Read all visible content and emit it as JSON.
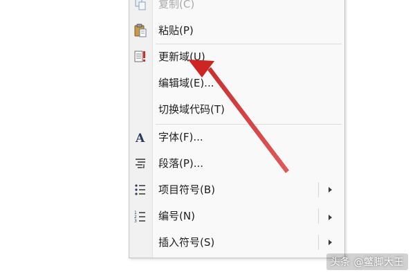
{
  "context_menu": {
    "items": [
      {
        "label": "复制(C)",
        "icon": "copy-icon",
        "disabled": true
      },
      {
        "label": "粘贴(P)",
        "icon": "paste-icon"
      },
      {
        "label": "更新域(U)",
        "icon": "update-field-icon"
      },
      {
        "label": "编辑域(E)...",
        "icon": ""
      },
      {
        "label": "切换域代码(T)",
        "icon": ""
      },
      {
        "label": "字体(F)...",
        "icon": "font-icon"
      },
      {
        "label": "段落(P)...",
        "icon": "paragraph-icon"
      },
      {
        "label": "项目符号(B)",
        "icon": "bullets-icon",
        "submenu": true
      },
      {
        "label": "编号(N)",
        "icon": "numbering-icon",
        "submenu": true
      },
      {
        "label": "插入符号(S)",
        "icon": "",
        "submenu": true
      }
    ]
  },
  "annotation": {
    "color": "#d42a2a",
    "target": "更新域(U)"
  },
  "watermark": {
    "text": "头条 @鳖脚大王"
  }
}
